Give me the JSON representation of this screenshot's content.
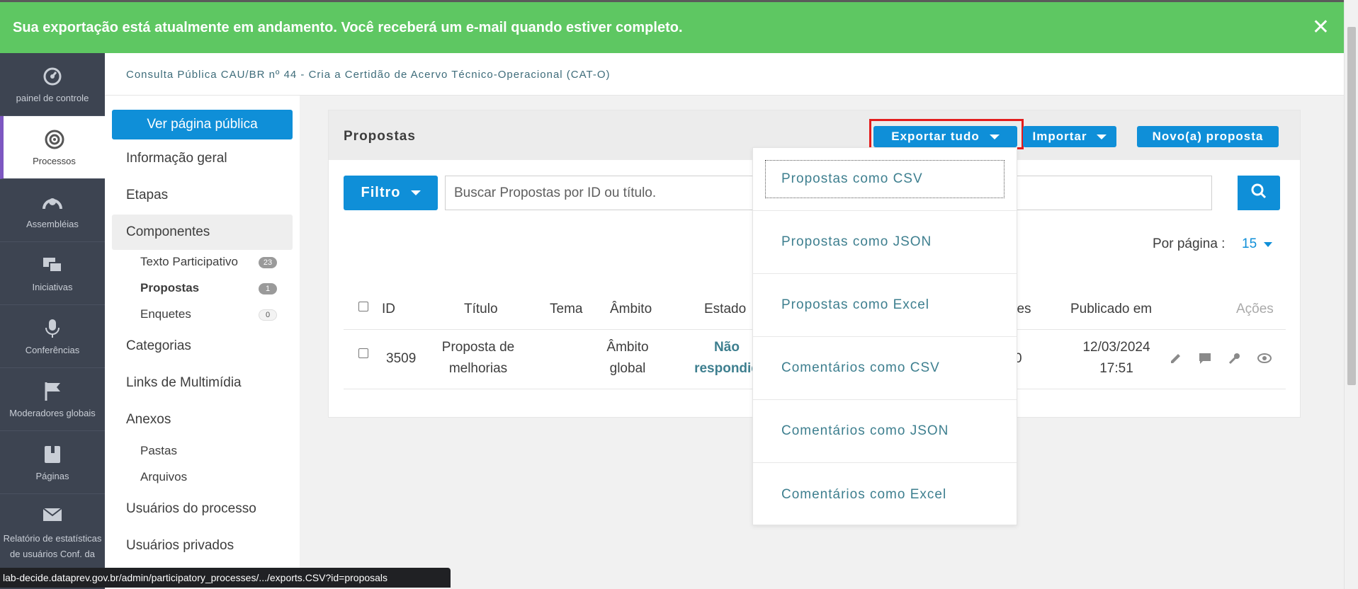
{
  "toast": {
    "message": "Sua exportação está atualmente em andamento. Você receberá um e-mail quando estiver completo."
  },
  "mainnav": {
    "items": [
      {
        "label": "painel de controle",
        "icon": "dashboard-icon"
      },
      {
        "label": "Processos",
        "icon": "target-icon"
      },
      {
        "label": "Assembléias",
        "icon": "assembly-icon"
      },
      {
        "label": "Iniciativas",
        "icon": "chat-icon"
      },
      {
        "label": "Conferências",
        "icon": "microphone-icon"
      },
      {
        "label": "Moderadores globais",
        "icon": "flag-icon"
      },
      {
        "label": "Páginas",
        "icon": "book-icon"
      },
      {
        "label": "Relatório de estatísticas de usuários Conf. da",
        "icon": "mail-icon"
      }
    ]
  },
  "breadcrumb": "Consulta Pública CAU/BR nº 44 - Cria a Certidão de Acervo Técnico-Operacional (CAT-O)",
  "secnav": {
    "public_button": "Ver página pública",
    "info": "Informação geral",
    "etapas": "Etapas",
    "componentes": "Componentes",
    "sub_components": [
      {
        "label": "Texto Participativo",
        "count": "23"
      },
      {
        "label": "Propostas",
        "count": "1"
      },
      {
        "label": "Enquetes",
        "count": "0"
      }
    ],
    "categorias": "Categorias",
    "links": "Links de Multimídia",
    "anexos": "Anexos",
    "pastas": "Pastas",
    "arquivos": "Arquivos",
    "usuarios_processo": "Usuários do processo",
    "usuarios_privados": "Usuários privados"
  },
  "card": {
    "title": "Propostas",
    "export_button": "Exportar tudo",
    "import_button": "Importar",
    "new_button": "Novo(a) proposta",
    "filter_button": "Filtro",
    "search_placeholder": "Buscar Propostas por ID ou título.",
    "per_page_label": "Por página :",
    "per_page_value": "15"
  },
  "table": {
    "headers": {
      "id": "ID",
      "titulo": "Título",
      "tema": "Tema",
      "ambito": "Âmbito",
      "estado": "Estado",
      "apoiadores": "dores",
      "publicado": "Publicado em",
      "acoes": "Ações"
    },
    "row": {
      "id": "3509",
      "titulo_1": "Proposta de",
      "titulo_2": "melhorias",
      "ambito_1": "Âmbito",
      "ambito_2": "global",
      "estado_1": "Não",
      "estado_2": "respondid",
      "apoiadores": "0",
      "data": "12/03/2024",
      "hora": "17:51"
    }
  },
  "export_menu": [
    "Propostas como CSV",
    "Propostas como JSON",
    "Propostas como Excel",
    "Comentários como CSV",
    "Comentários como JSON",
    "Comentários como Excel"
  ],
  "statusbar": "lab-decide.dataprev.gov.br/admin/participatory_processes/.../exports.CSV?id=proposals",
  "colors": {
    "accent": "#0f8fd8",
    "toast": "#5ec762",
    "nav": "#3d4451",
    "highlight": "#e31c1c"
  }
}
